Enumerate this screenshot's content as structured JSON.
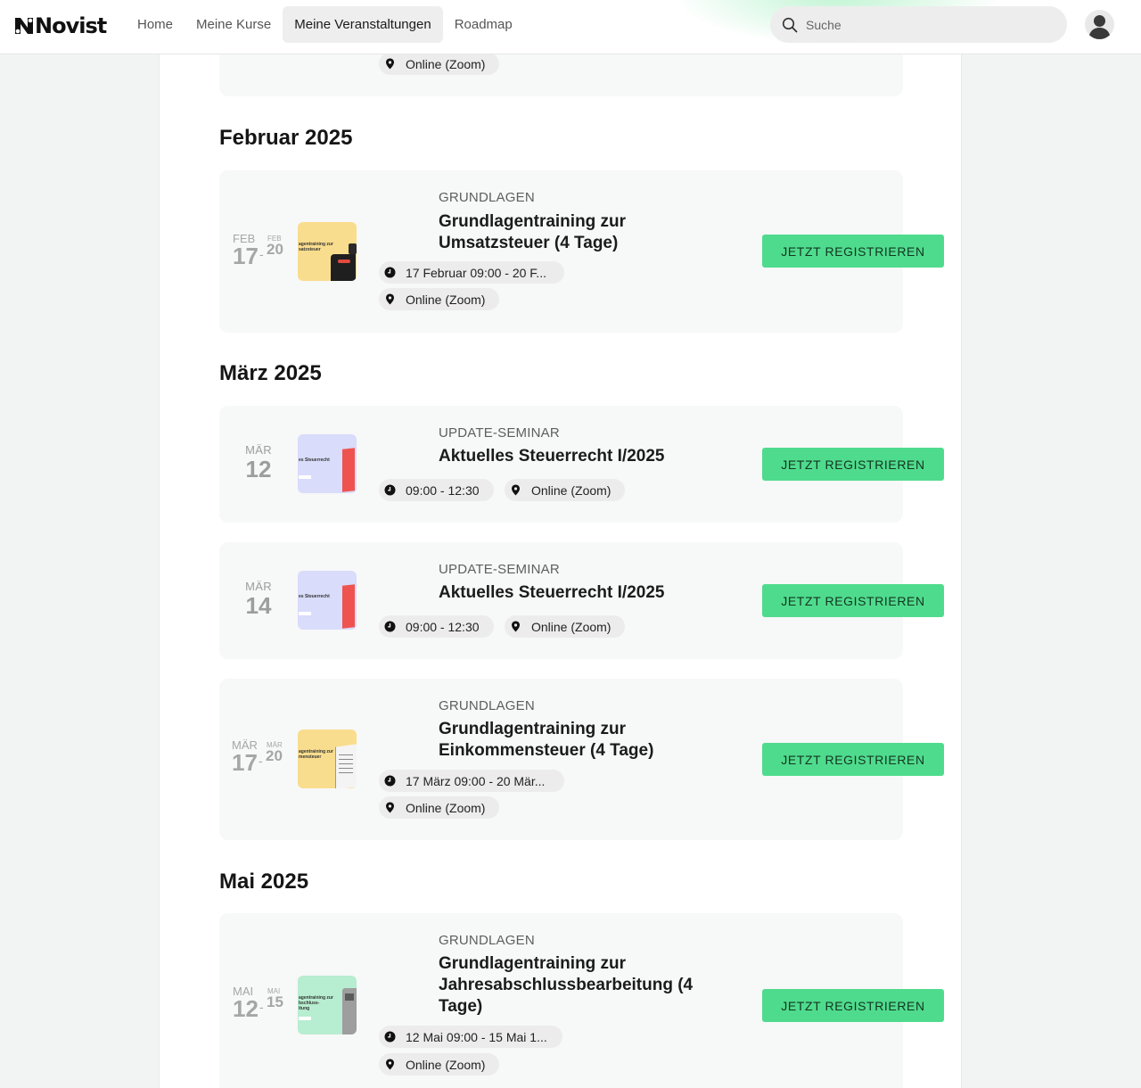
{
  "brand": {
    "name": "Novist"
  },
  "nav": {
    "items": [
      {
        "label": "Home",
        "active": false
      },
      {
        "label": "Meine Kurse",
        "active": false
      },
      {
        "label": "Meine Veranstaltungen",
        "active": true
      },
      {
        "label": "Roadmap",
        "active": false
      }
    ]
  },
  "search": {
    "placeholder": "Suche"
  },
  "colors": {
    "accent": "#4fdb8d",
    "card": "#f7f8f8",
    "pill": "#ececed"
  },
  "prev_event": {
    "location": "Online (Zoom)"
  },
  "months": [
    {
      "heading": "Februar 2025",
      "events": [
        {
          "date_from_month": "FEB",
          "date_from_day": "17",
          "date_to_month": "FEB",
          "date_to_day": "20",
          "thumb_text": "agentraining zur\nsatzsteuer",
          "category": "GRUNDLAGEN",
          "title": "Grundlagentraining zur Umsatzsteuer (4 Tage)",
          "time": "17 Februar 09:00 - 20 F...",
          "location": "Online (Zoom)",
          "button": "JETZT REGISTRIEREN"
        }
      ]
    },
    {
      "heading": "März 2025",
      "events": [
        {
          "date_month": "MÄR",
          "date_day": "12",
          "thumb_text": "es Steuerrecht",
          "category": "UPDATE-SEMINAR",
          "title": "Aktuelles Steuerrecht I/2025",
          "time": "09:00 - 12:30",
          "location": "Online (Zoom)",
          "button": "JETZT REGISTRIEREN"
        },
        {
          "date_month": "MÄR",
          "date_day": "14",
          "thumb_text": "es Steuerrecht",
          "category": "UPDATE-SEMINAR",
          "title": "Aktuelles Steuerrecht I/2025",
          "time": "09:00 - 12:30",
          "location": "Online (Zoom)",
          "button": "JETZT REGISTRIEREN"
        },
        {
          "date_from_month": "MÄR",
          "date_from_day": "17",
          "date_to_month": "MÄR",
          "date_to_day": "20",
          "thumb_text": "agentraining zur\nmensteuer",
          "category": "GRUNDLAGEN",
          "title": "Grundlagentraining zur Einkommensteuer (4 Tage)",
          "time": "17 März 09:00 - 20 Mär...",
          "location": "Online (Zoom)",
          "button": "JETZT REGISTRIEREN"
        }
      ]
    },
    {
      "heading": "Mai 2025",
      "events": [
        {
          "date_from_month": "MAI",
          "date_from_day": "12",
          "date_to_month": "MAI",
          "date_to_day": "15",
          "thumb_text": "agentraining zur\nbschluss-\nitung",
          "category": "GRUNDLAGEN",
          "title": "Grundlagentraining zur Jahresabschlussbearbeitung (4 Tage)",
          "time": "12 Mai 09:00 - 15 Mai 1...",
          "location": "Online (Zoom)",
          "button": "JETZT REGISTRIEREN"
        }
      ]
    }
  ]
}
